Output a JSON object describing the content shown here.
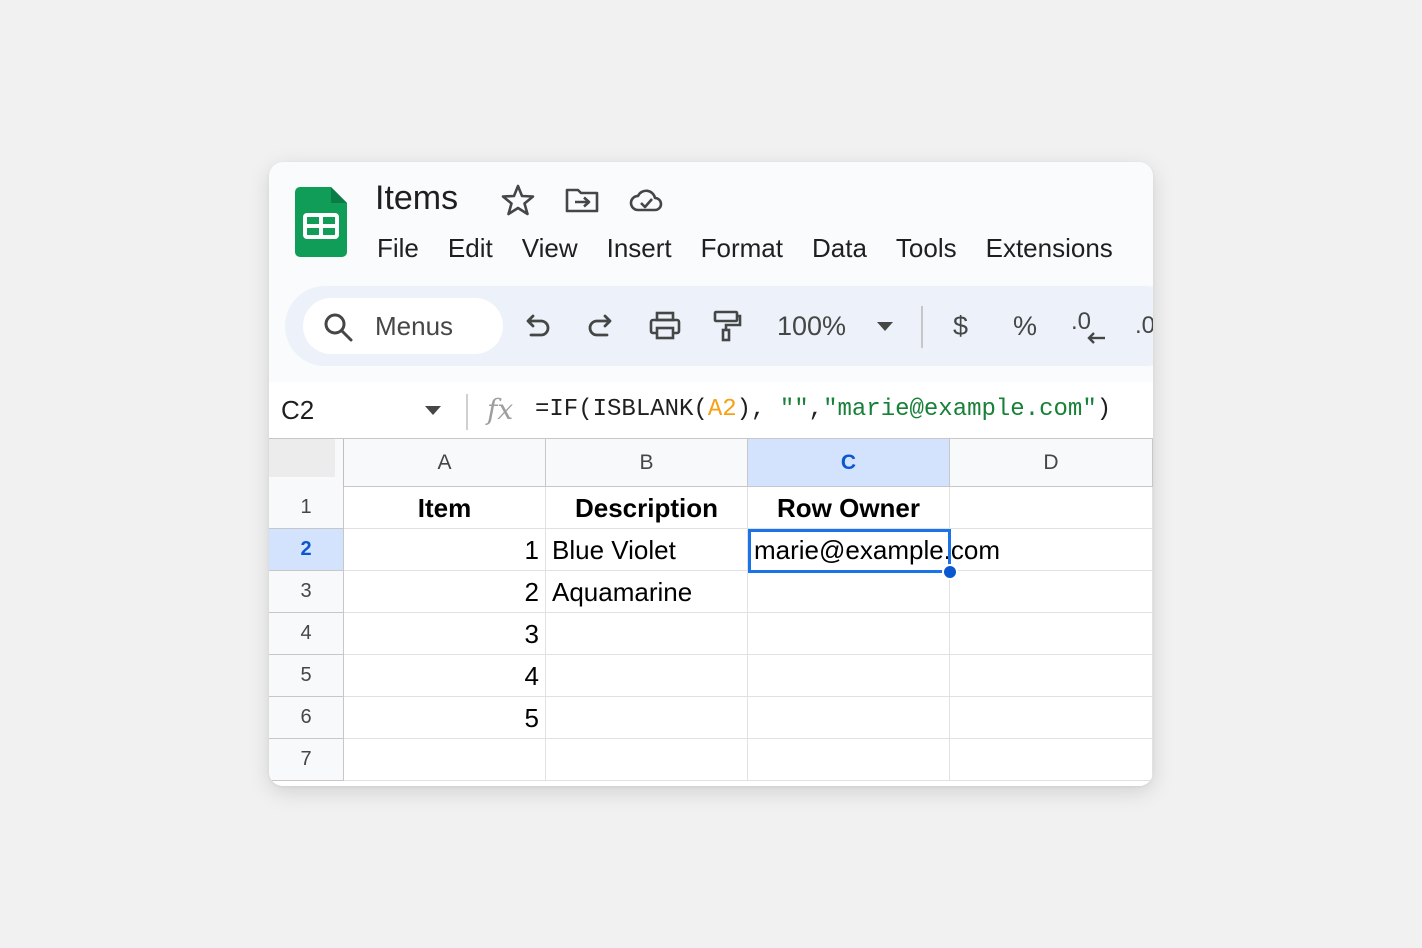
{
  "app": {
    "title": "Items",
    "icons": [
      "sheets-logo-icon",
      "star-icon",
      "move-to-folder-icon",
      "cloud-saved-icon"
    ]
  },
  "menubar": {
    "items": [
      "File",
      "Edit",
      "View",
      "Insert",
      "Format",
      "Data",
      "Tools",
      "Extensions"
    ]
  },
  "toolbar": {
    "search_label": "Menus",
    "zoom": "100%",
    "currency": "$",
    "percent": "%",
    "decrease_decimal": ".0",
    "increase_decimal": ".0"
  },
  "formula_bar": {
    "name_box": "C2",
    "fx": "fx",
    "formula_parts": {
      "p1": "=IF(ISBLANK(",
      "ref": "A2",
      "p2": "), ",
      "s1": "\"\"",
      "p3": ",",
      "s2": "\"marie@example.com\"",
      "p4": ")"
    }
  },
  "grid": {
    "columns": [
      "A",
      "B",
      "C",
      "D"
    ],
    "selected_column": "C",
    "rows": [
      "1",
      "2",
      "3",
      "4",
      "5",
      "6",
      "7"
    ],
    "selected_row": "2",
    "cells": {
      "A1": "Item",
      "B1": "Description",
      "C1": "Row Owner",
      "D1": "",
      "A2": "1",
      "B2": "Blue Violet",
      "C2": "marie@example.com",
      "D2": "",
      "A3": "2",
      "B3": "Aquamarine",
      "C3": "",
      "D3": "",
      "A4": "3",
      "B4": "",
      "C4": "",
      "D4": "",
      "A5": "4",
      "B5": "",
      "C5": "",
      "D5": "",
      "A6": "5",
      "B6": "",
      "C6": "",
      "D6": "",
      "A7": "",
      "B7": "",
      "C7": "",
      "D7": ""
    }
  },
  "colors": {
    "sheets_green": "#0f9d58",
    "selection_blue": "#1a73e8",
    "header_selected": "#d3e3fd",
    "toolbar_bg": "#edf2fa",
    "formula_ref": "#f7a013",
    "formula_string": "#188038"
  }
}
